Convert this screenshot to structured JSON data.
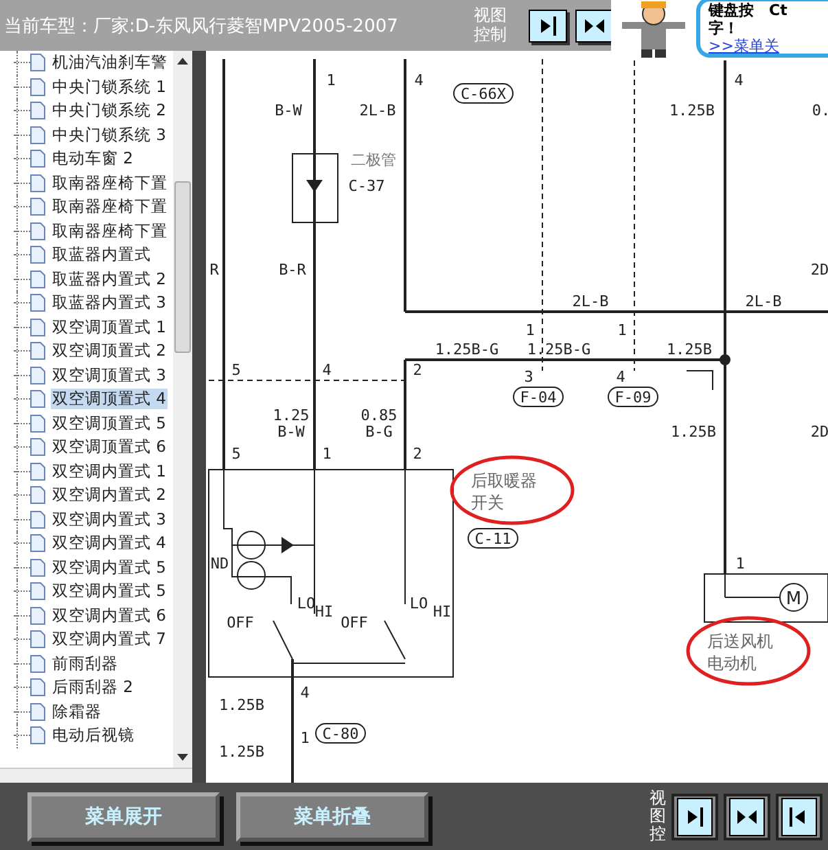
{
  "header": {
    "title": "当前车型：厂家:D-东风风行菱智MPV2005-2007",
    "view_control_label": "视图控制"
  },
  "popup": {
    "lines": [
      "键盘按　Ct",
      "字！"
    ],
    "link": ">>菜单关"
  },
  "tree": {
    "items": [
      {
        "label": "机油汽油刹车警",
        "selected": false
      },
      {
        "label": "中央门锁系统 1",
        "selected": false
      },
      {
        "label": "中央门锁系统 2",
        "selected": false
      },
      {
        "label": "中央门锁系统 3",
        "selected": false
      },
      {
        "label": "电动车窗 2",
        "selected": false
      },
      {
        "label": "取南器座椅下置",
        "selected": false
      },
      {
        "label": "取南器座椅下置",
        "selected": false
      },
      {
        "label": "取南器座椅下置",
        "selected": false
      },
      {
        "label": "取蓝器内置式",
        "selected": false
      },
      {
        "label": "取蓝器内置式 2",
        "selected": false
      },
      {
        "label": "取蓝器内置式 3",
        "selected": false
      },
      {
        "label": "双空调顶置式 1",
        "selected": false
      },
      {
        "label": "双空调顶置式 2",
        "selected": false
      },
      {
        "label": "双空调顶置式 3",
        "selected": false
      },
      {
        "label": "双空调顶置式 4",
        "selected": true
      },
      {
        "label": "双空调顶置式 5",
        "selected": false
      },
      {
        "label": "双空调顶置式 6",
        "selected": false
      },
      {
        "label": "双空调内置式 1",
        "selected": false
      },
      {
        "label": "双空调内置式 2",
        "selected": false
      },
      {
        "label": "双空调内置式 3",
        "selected": false
      },
      {
        "label": "双空调内置式 4",
        "selected": false
      },
      {
        "label": "双空调内置式 5",
        "selected": false
      },
      {
        "label": "双空调内置式 5",
        "selected": false
      },
      {
        "label": "双空调内置式 6",
        "selected": false
      },
      {
        "label": "双空调内置式 7",
        "selected": false
      },
      {
        "label": "前雨刮器",
        "selected": false
      },
      {
        "label": "后雨刮器 2",
        "selected": false
      },
      {
        "label": "除霜器",
        "selected": false
      },
      {
        "label": "电动后视镜",
        "selected": false
      }
    ]
  },
  "diagram": {
    "labels": [
      {
        "kind": "pin",
        "text": "1"
      },
      {
        "kind": "pin",
        "text": "4"
      },
      {
        "kind": "pin",
        "text": "4"
      },
      {
        "kind": "connector",
        "text": "C-66X"
      },
      {
        "kind": "wire",
        "text": "B-W"
      },
      {
        "kind": "wire",
        "text": "2L-B"
      },
      {
        "kind": "wire",
        "text": "1.25B"
      },
      {
        "kind": "wire",
        "text": "0."
      },
      {
        "kind": "component",
        "text": "二极管"
      },
      {
        "kind": "wire",
        "text": "C-37"
      },
      {
        "kind": "wire",
        "text": "R"
      },
      {
        "kind": "wire",
        "text": "B-R"
      },
      {
        "kind": "wire",
        "text": "2D"
      },
      {
        "kind": "wire",
        "text": "2L-B"
      },
      {
        "kind": "wire",
        "text": "2L-B"
      },
      {
        "kind": "pin",
        "text": "1"
      },
      {
        "kind": "pin",
        "text": "1"
      },
      {
        "kind": "wire",
        "text": "1.25B-G"
      },
      {
        "kind": "wire",
        "text": "1.25B-G"
      },
      {
        "kind": "wire",
        "text": "1.25B"
      },
      {
        "kind": "pin",
        "text": "5"
      },
      {
        "kind": "pin",
        "text": "4"
      },
      {
        "kind": "pin",
        "text": "2"
      },
      {
        "kind": "pin",
        "text": "3"
      },
      {
        "kind": "pin",
        "text": "4"
      },
      {
        "kind": "connector",
        "text": "F-04"
      },
      {
        "kind": "connector",
        "text": "F-09"
      },
      {
        "kind": "wire",
        "text": "1.25"
      },
      {
        "kind": "wire",
        "text": "0.85"
      },
      {
        "kind": "wire",
        "text": "B-W"
      },
      {
        "kind": "wire",
        "text": "B-G"
      },
      {
        "kind": "wire",
        "text": "1.25B"
      },
      {
        "kind": "wire",
        "text": "2D"
      },
      {
        "kind": "pin",
        "text": "5"
      },
      {
        "kind": "pin",
        "text": "1"
      },
      {
        "kind": "pin",
        "text": "2"
      },
      {
        "kind": "note",
        "text": "后取暖器",
        "text_2": "开关"
      },
      {
        "kind": "connector",
        "text": "C-11"
      },
      {
        "kind": "pin",
        "text": "1"
      },
      {
        "kind": "wire",
        "text": "ND"
      },
      {
        "kind": "wire",
        "text": "LO"
      },
      {
        "kind": "wire",
        "text": "HI"
      },
      {
        "kind": "wire",
        "text": "OFF"
      },
      {
        "kind": "wire",
        "text": "LO"
      },
      {
        "kind": "wire",
        "text": "HI"
      },
      {
        "kind": "wire",
        "text": "OFF"
      },
      {
        "kind": "note",
        "text": "后送风机",
        "text_2": "电动机"
      },
      {
        "kind": "pin",
        "text": "4"
      },
      {
        "kind": "wire",
        "text": "1.25B"
      },
      {
        "kind": "pin",
        "text": "1"
      },
      {
        "kind": "connector",
        "text": "C-80"
      },
      {
        "kind": "wire",
        "text": "1.25B"
      }
    ]
  },
  "motor_symbol": "M",
  "footer": {
    "buttons": [
      "菜单展开",
      "菜单折叠"
    ],
    "view_control_label": "视图控"
  }
}
